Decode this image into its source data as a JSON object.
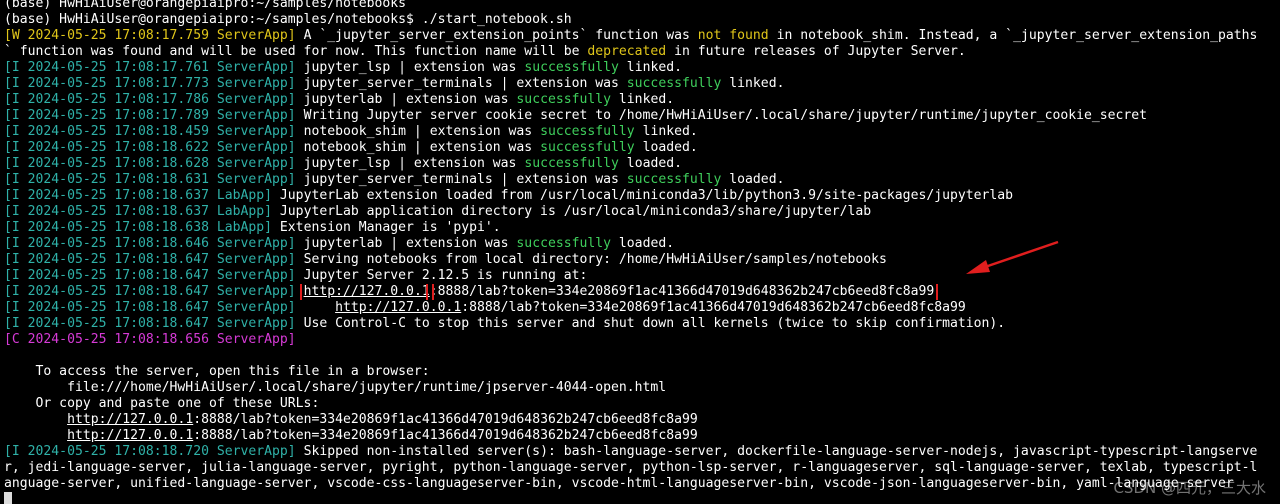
{
  "window": {
    "title_line": "(base) HwHiAiUser@orangepiaipro:~/samples/notebooks"
  },
  "colors": {
    "background": "#000000",
    "log_tag": "#2fb1a8",
    "warning_tag": "#e0c61a",
    "critical_tag": "#d63ad6",
    "success_text": "#3fcf5c",
    "highlight_box": "#e01e1e",
    "arrow": "#e01e1e"
  },
  "terminal": {
    "lines": [
      {
        "segments": [
          {
            "text": "(base) HwHiAiUser@orangepiaipro:~/samples/notebooks"
          }
        ]
      },
      {
        "segments": [
          {
            "text": "(base) HwHiAiUser@orangepiaipro:~/samples/notebooks$ ./start_notebook.sh"
          }
        ]
      },
      {
        "segments": [
          {
            "text": "[W 2024-05-25 17:08:17.759 ServerApp]",
            "cls": "tag-w"
          },
          {
            "text": " A `_jupyter_server_extension_points` function was "
          },
          {
            "text": "not found",
            "cls": "hl-yellow"
          },
          {
            "text": " in notebook_shim. Instead, a `_jupyter_server_extension_paths"
          }
        ]
      },
      {
        "segments": [
          {
            "text": "` function was found and will be used for now. This function name will be "
          },
          {
            "text": "deprecated",
            "cls": "hl-yellow"
          },
          {
            "text": " in future releases of Jupyter Server."
          }
        ]
      },
      {
        "segments": [
          {
            "text": "[I 2024-05-25 17:08:17.761 ServerApp]",
            "cls": "tag-i"
          },
          {
            "text": " jupyter_lsp | extension was "
          },
          {
            "text": "successfully",
            "cls": "hl-green"
          },
          {
            "text": " linked."
          }
        ]
      },
      {
        "segments": [
          {
            "text": "[I 2024-05-25 17:08:17.773 ServerApp]",
            "cls": "tag-i"
          },
          {
            "text": " jupyter_server_terminals | extension was "
          },
          {
            "text": "successfully",
            "cls": "hl-green"
          },
          {
            "text": " linked."
          }
        ]
      },
      {
        "segments": [
          {
            "text": "[I 2024-05-25 17:08:17.786 ServerApp]",
            "cls": "tag-i"
          },
          {
            "text": " jupyterlab | extension was "
          },
          {
            "text": "successfully",
            "cls": "hl-green"
          },
          {
            "text": " linked."
          }
        ]
      },
      {
        "segments": [
          {
            "text": "[I 2024-05-25 17:08:17.789 ServerApp]",
            "cls": "tag-i"
          },
          {
            "text": " Writing Jupyter server cookie secret to /home/HwHiAiUser/.local/share/jupyter/runtime/jupyter_cookie_secret"
          }
        ]
      },
      {
        "segments": [
          {
            "text": "[I 2024-05-25 17:08:18.459 ServerApp]",
            "cls": "tag-i"
          },
          {
            "text": " notebook_shim | extension was "
          },
          {
            "text": "successfully",
            "cls": "hl-green"
          },
          {
            "text": " linked."
          }
        ]
      },
      {
        "segments": [
          {
            "text": "[I 2024-05-25 17:08:18.622 ServerApp]",
            "cls": "tag-i"
          },
          {
            "text": " notebook_shim | extension was "
          },
          {
            "text": "successfully",
            "cls": "hl-green"
          },
          {
            "text": " loaded."
          }
        ]
      },
      {
        "segments": [
          {
            "text": "[I 2024-05-25 17:08:18.628 ServerApp]",
            "cls": "tag-i"
          },
          {
            "text": " jupyter_lsp | extension was "
          },
          {
            "text": "successfully",
            "cls": "hl-green"
          },
          {
            "text": " loaded."
          }
        ]
      },
      {
        "segments": [
          {
            "text": "[I 2024-05-25 17:08:18.631 ServerApp]",
            "cls": "tag-i"
          },
          {
            "text": " jupyter_server_terminals | extension was "
          },
          {
            "text": "successfully",
            "cls": "hl-green"
          },
          {
            "text": " loaded."
          }
        ]
      },
      {
        "segments": [
          {
            "text": "[I 2024-05-25 17:08:18.637 LabApp]",
            "cls": "tag-i"
          },
          {
            "text": " JupyterLab extension loaded from /usr/local/miniconda3/lib/python3.9/site-packages/jupyterlab"
          }
        ]
      },
      {
        "segments": [
          {
            "text": "[I 2024-05-25 17:08:18.637 LabApp]",
            "cls": "tag-i"
          },
          {
            "text": " JupyterLab application directory is /usr/local/miniconda3/share/jupyter/lab"
          }
        ]
      },
      {
        "segments": [
          {
            "text": "[I 2024-05-25 17:08:18.638 LabApp]",
            "cls": "tag-i"
          },
          {
            "text": " Extension Manager is 'pypi'."
          }
        ]
      },
      {
        "segments": [
          {
            "text": "[I 2024-05-25 17:08:18.646 ServerApp]",
            "cls": "tag-i"
          },
          {
            "text": " jupyterlab | extension was "
          },
          {
            "text": "successfully",
            "cls": "hl-green"
          },
          {
            "text": " loaded."
          }
        ]
      },
      {
        "segments": [
          {
            "text": "[I 2024-05-25 17:08:18.647 ServerApp]",
            "cls": "tag-i"
          },
          {
            "text": " Serving notebooks from local directory: /home/HwHiAiUser/samples/notebooks"
          }
        ]
      },
      {
        "segments": [
          {
            "text": "[I 2024-05-25 17:08:18.647 ServerApp]",
            "cls": "tag-i"
          },
          {
            "text": " Jupyter Server 2.12.5 is running at:"
          }
        ]
      },
      {
        "segments": [
          {
            "text": "[I 2024-05-25 17:08:18.647 ServerApp]",
            "cls": "tag-i"
          },
          {
            "text": " "
          },
          {
            "text": "http://127.0.0.1",
            "cls": "url url-boxed",
            "link": true
          },
          {
            "text": ":8888/lab?token=334e20869f1ac41366d47019d648362b247cb6eed8fc8a99",
            "cls": "url-boxed"
          }
        ]
      },
      {
        "segments": [
          {
            "text": "[I 2024-05-25 17:08:18.647 ServerApp]",
            "cls": "tag-i"
          },
          {
            "text": "     "
          },
          {
            "text": "http://127.0.0.1",
            "cls": "url",
            "link": true
          },
          {
            "text": ":8888/lab?token=334e20869f1ac41366d47019d648362b247cb6eed8fc8a99"
          }
        ]
      },
      {
        "segments": [
          {
            "text": "[I 2024-05-25 17:08:18.647 ServerApp]",
            "cls": "tag-i"
          },
          {
            "text": " Use Control-C to stop this server and shut down all kernels (twice to skip confirmation)."
          }
        ]
      },
      {
        "segments": [
          {
            "text": "[C 2024-05-25 17:08:18.656 ServerApp]",
            "cls": "tag-c"
          }
        ]
      },
      {
        "segments": [
          {
            "text": ""
          }
        ]
      },
      {
        "segments": [
          {
            "text": "    To access the server, open this file in a browser:"
          }
        ]
      },
      {
        "segments": [
          {
            "text": "        file:///home/HwHiAiUser/.local/share/jupyter/runtime/jpserver-4044-open.html"
          }
        ]
      },
      {
        "segments": [
          {
            "text": "    Or copy and paste one of these URLs:"
          }
        ]
      },
      {
        "segments": [
          {
            "text": "        "
          },
          {
            "text": "http://127.0.0.1",
            "cls": "url",
            "link": true
          },
          {
            "text": ":8888/lab?token=334e20869f1ac41366d47019d648362b247cb6eed8fc8a99"
          }
        ]
      },
      {
        "segments": [
          {
            "text": "        "
          },
          {
            "text": "http://127.0.0.1",
            "cls": "url",
            "link": true
          },
          {
            "text": ":8888/lab?token=334e20869f1ac41366d47019d648362b247cb6eed8fc8a99"
          }
        ]
      },
      {
        "segments": [
          {
            "text": "[I 2024-05-25 17:08:18.720 ServerApp]",
            "cls": "tag-i"
          },
          {
            "text": " Skipped non-installed server(s): bash-language-server, dockerfile-language-server-nodejs, javascript-typescript-langserve"
          }
        ]
      },
      {
        "segments": [
          {
            "text": "r, jedi-language-server, julia-language-server, pyright, python-language-server, python-lsp-server, r-languageserver, sql-language-server, texlab, typescript-l"
          }
        ]
      },
      {
        "segments": [
          {
            "text": "anguage-server, unified-language-server, vscode-css-languageserver-bin, vscode-html-languageserver-bin, vscode-json-languageserver-bin, yaml-language-server"
          }
        ]
      }
    ]
  },
  "watermark": "CSDN @四元，三大水"
}
